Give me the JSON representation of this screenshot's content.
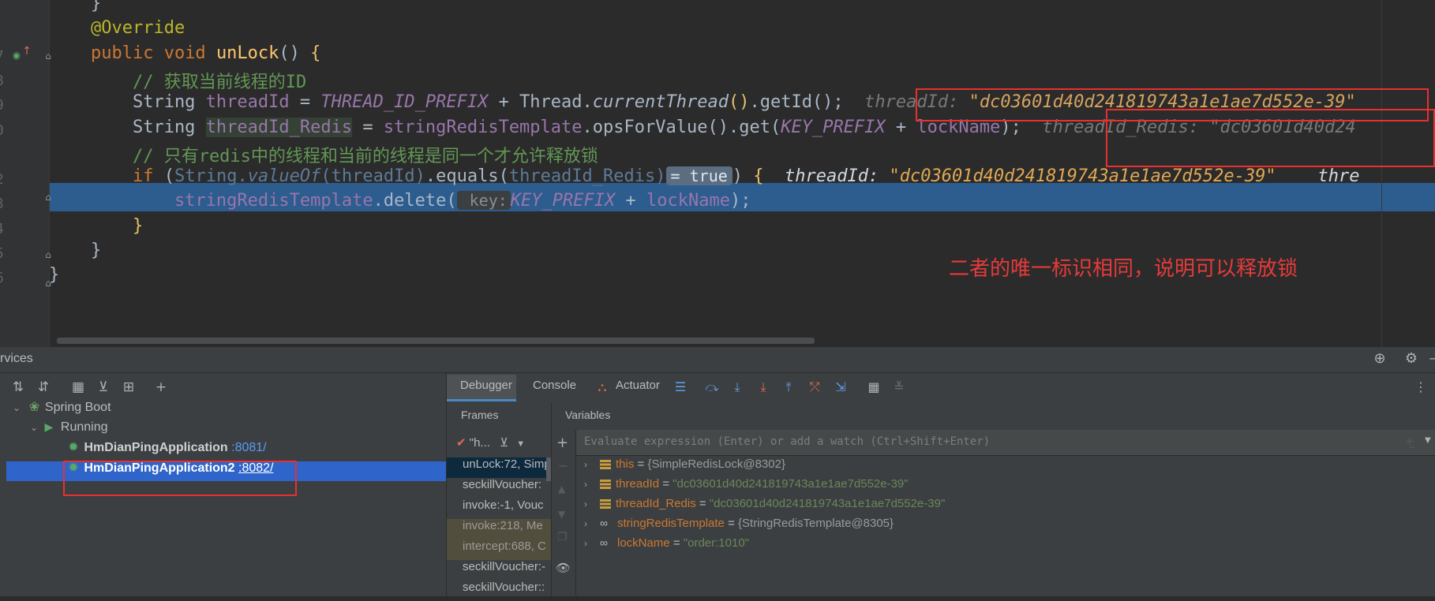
{
  "editor": {
    "lines": [
      {
        "number": "",
        "tokens": [
          {
            "t": "    }",
            "c": "plain"
          }
        ]
      },
      {
        "number": "",
        "tokens": [
          {
            "t": "    @Override",
            "c": "ann"
          }
        ]
      },
      {
        "number": "7",
        "tokens": [
          {
            "t": "    ",
            "c": "plain"
          },
          {
            "t": "public void ",
            "c": "kw"
          },
          {
            "t": "unLock",
            "c": "fn"
          },
          {
            "t": "() ",
            "c": "plain"
          },
          {
            "t": "{",
            "c": "brace"
          }
        ]
      },
      {
        "number": "8",
        "tokens": [
          {
            "t": "        // 获取当前线程的ID",
            "c": "cmt"
          }
        ]
      },
      {
        "number": "9",
        "tokens": [
          {
            "t": "        String ",
            "c": "plain"
          },
          {
            "t": "threadId",
            "c": "fld"
          },
          {
            "t": " = ",
            "c": "plain"
          },
          {
            "t": "THREAD_ID_PREFIX",
            "c": "const"
          },
          {
            "t": " + Thread.",
            "c": "plain"
          },
          {
            "t": "currentThread",
            "c": "it"
          },
          {
            "t": "()",
            "c": "brace"
          },
          {
            "t": ".getId();  ",
            "c": "plain"
          },
          {
            "t": "threadId: ",
            "c": "inlay"
          },
          {
            "t": "\"dc03601d40d241819743a1e1ae7d552e-39\"",
            "c": "inlay-str"
          }
        ]
      },
      {
        "number": "0",
        "tokens": [
          {
            "t": "        String ",
            "c": "plain"
          },
          {
            "t": "threadId_Redis",
            "c": "fld-hl"
          },
          {
            "t": " = ",
            "c": "plain"
          },
          {
            "t": "stringRedisTemplate",
            "c": "fld"
          },
          {
            "t": ".opsForValue().get(",
            "c": "plain"
          },
          {
            "t": "KEY_PREFIX",
            "c": "const"
          },
          {
            "t": " + ",
            "c": "plain"
          },
          {
            "t": "lockName",
            "c": "fld"
          },
          {
            "t": ");  ",
            "c": "plain"
          },
          {
            "t": "threadId_Redis: ",
            "c": "inlay"
          },
          {
            "t": "\"dc03601d40d24",
            "c": "inlay"
          }
        ]
      },
      {
        "number": "",
        "tokens": [
          {
            "t": "        // 只有redis中的线程和当前的线程是同一个才允许释放锁",
            "c": "cmt"
          }
        ]
      },
      {
        "number": "2",
        "tokens": [
          {
            "t": "        ",
            "c": "plain"
          },
          {
            "t": "if ",
            "c": "kw"
          },
          {
            "t": "(",
            "c": "plain"
          },
          {
            "t": "String.",
            "c": "dim"
          },
          {
            "t": "valueOf",
            "c": "dim-it"
          },
          {
            "t": "(",
            "c": "dim"
          },
          {
            "t": "threadId",
            "c": "dim"
          },
          {
            "t": ")",
            "c": "dim"
          },
          {
            "t": ".equals(",
            "c": "plain"
          },
          {
            "t": "threadId_Redis",
            "c": "dim"
          },
          {
            "t": ")",
            "c": "dim"
          },
          {
            "t": "= true",
            "c": "badge"
          },
          {
            "t": ") ",
            "c": "plain"
          },
          {
            "t": "{",
            "c": "brace"
          },
          {
            "t": "  threadId: ",
            "c": "inlay-w"
          },
          {
            "t": "\"dc03601d40d241819743a1e1ae7d552e-39\"",
            "c": "inlay-str"
          },
          {
            "t": "    thre",
            "c": "inlay-w"
          }
        ]
      },
      {
        "number": "3",
        "tokens": [
          {
            "t": "            stringRedisTemplate",
            "c": "fld"
          },
          {
            "t": ".delete(",
            "c": "plain"
          },
          {
            "t": " key:",
            "c": "hint"
          },
          {
            "t": "KEY_PREFIX",
            "c": "const"
          },
          {
            "t": " + ",
            "c": "plain"
          },
          {
            "t": "lockName",
            "c": "fld"
          },
          {
            "t": ");",
            "c": "plain"
          }
        ]
      },
      {
        "number": "4",
        "tokens": [
          {
            "t": "        }",
            "c": "brace"
          }
        ]
      },
      {
        "number": "5",
        "tokens": [
          {
            "t": "    }",
            "c": "plain"
          }
        ]
      },
      {
        "number": "6",
        "tokens": [
          {
            "t": "}",
            "c": "plain"
          }
        ]
      }
    ],
    "annotation": "二者的唯一标识相同，说明可以释放锁"
  },
  "services": {
    "title": "rvices",
    "tree": {
      "root": "Spring Boot",
      "group": "Running",
      "apps": [
        {
          "name": "HmDianPingApplication",
          "port": ":8081/",
          "selected": false
        },
        {
          "name": "HmDianPingApplication2",
          "port": ":8082/",
          "selected": true
        }
      ]
    },
    "tabs": {
      "debugger": "Debugger",
      "console": "Console",
      "actuator": "Actuator"
    },
    "frames": {
      "title": "Frames",
      "thread_filter": "\"h...",
      "items": [
        {
          "label": "unLock:72, Simp",
          "kind": "selected"
        },
        {
          "label": "seckillVoucher:",
          "kind": "normal"
        },
        {
          "label": "invoke:-1, Vouc",
          "kind": "normal"
        },
        {
          "label": "invoke:218, Me",
          "kind": "lib"
        },
        {
          "label": "intercept:688, C",
          "kind": "lib"
        },
        {
          "label": "seckillVoucher:-",
          "kind": "normal"
        },
        {
          "label": "seckillVoucher::",
          "kind": "normal"
        }
      ]
    },
    "variables": {
      "title": "Variables",
      "eval_placeholder": "Evaluate expression (Enter) or add a watch (Ctrl+Shift+Enter)",
      "items": [
        {
          "name": "this",
          "value": "{SimpleRedisLock@8302}",
          "kind": "obj",
          "icon": "field-icon"
        },
        {
          "name": "threadId",
          "value": "\"dc03601d40d241819743a1e1ae7d552e-39\"",
          "kind": "str",
          "icon": "field-icon"
        },
        {
          "name": "threadId_Redis",
          "value": "\"dc03601d40d241819743a1e1ae7d552e-39\"",
          "kind": "str",
          "icon": "field-icon"
        },
        {
          "name": "stringRedisTemplate",
          "value": "{StringRedisTemplate@8305}",
          "kind": "obj",
          "icon": "watch-oo-icon"
        },
        {
          "name": "lockName",
          "value": "\"order:1010\"",
          "kind": "str",
          "icon": "watch-oo-icon"
        }
      ]
    }
  },
  "colors": {
    "highlight_line": "#2d5c8f",
    "annotation_red": "#e83a3a",
    "tree_selection": "#2f65ca"
  }
}
